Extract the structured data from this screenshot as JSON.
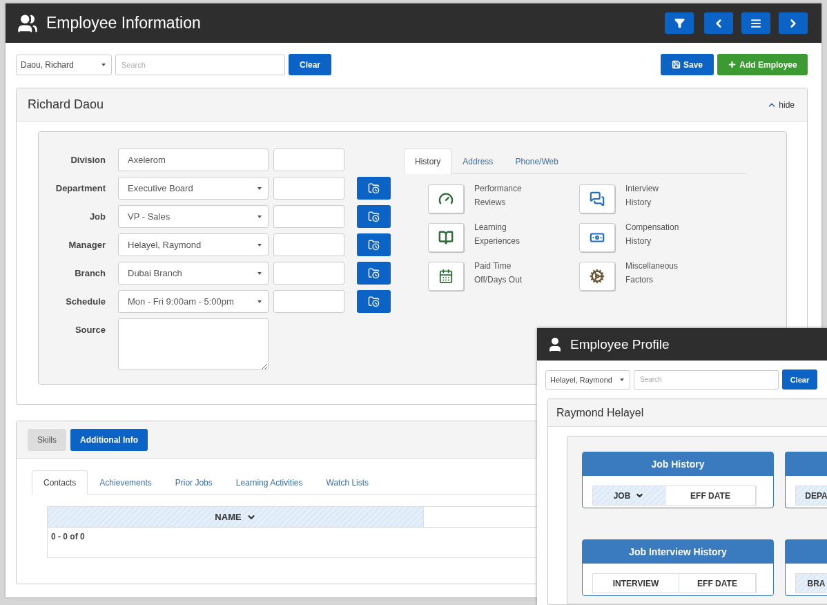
{
  "window": {
    "title": "Employee Information"
  },
  "toolbar": {
    "employee": "Daou, Richard",
    "search": {
      "placeholder": "Search"
    },
    "clear": "Clear",
    "save": "Save",
    "add": "Add Employee"
  },
  "employee_panel": {
    "title": "Richard Daou",
    "hide": "hide",
    "fields": [
      {
        "label": "Division",
        "kind": "text",
        "value": "Axelerom"
      },
      {
        "label": "Department",
        "kind": "select",
        "value": "Executive Board"
      },
      {
        "label": "Job",
        "kind": "select",
        "value": "VP - Sales"
      },
      {
        "label": "Manager",
        "kind": "select",
        "value": "Helayel, Raymond"
      },
      {
        "label": "Branch",
        "kind": "select",
        "value": "Dubai Branch"
      },
      {
        "label": "Schedule",
        "kind": "select",
        "value": "Mon - Fri 9:00am - 5:00pm"
      },
      {
        "label": "Source",
        "kind": "textarea"
      }
    ],
    "tabs": [
      {
        "label": "History",
        "selected": true
      },
      {
        "label": "Address",
        "selected": false
      },
      {
        "label": "Phone/Web",
        "selected": false
      }
    ],
    "links": [
      {
        "label": "Performance Reviews",
        "kind": "gauge"
      },
      {
        "label": "Interview History",
        "kind": "chat"
      },
      {
        "label": "Learning Experiences",
        "kind": "book"
      },
      {
        "label": "Compensation History",
        "kind": "money"
      },
      {
        "label": "Paid Time Off/Days Out",
        "kind": "calendar"
      },
      {
        "label": "Miscellaneous Factors",
        "kind": "gears"
      }
    ]
  },
  "bottom_panel": {
    "tabs": [
      {
        "label": "Skills",
        "selected": false
      },
      {
        "label": "Additional Info",
        "selected": true
      }
    ],
    "subtabs": [
      {
        "label": "Contacts",
        "selected": true
      },
      {
        "label": "Achievements",
        "selected": false
      },
      {
        "label": "Prior Jobs",
        "selected": false
      },
      {
        "label": "Learning Activities",
        "selected": false
      },
      {
        "label": "Watch Lists",
        "selected": false
      }
    ],
    "table": {
      "columns": [
        {
          "label": "NAME",
          "shaded": true,
          "sort_icon": true
        }
      ],
      "footer": "0 - 0 of 0"
    }
  },
  "profile_window": {
    "title": "Employee Profile",
    "employee": "Helayel, Raymond",
    "search": {
      "placeholder": "Search"
    },
    "clear": "Clear",
    "panel_title": "Raymond Helayel",
    "cards": [
      {
        "title": "Job History",
        "columns": [
          {
            "label": "JOB",
            "shaded": true,
            "sort_icon": true
          },
          {
            "label": "EFF DATE",
            "shaded": false,
            "sort_icon": false
          }
        ]
      },
      {
        "columns": [
          {
            "label": "DEPA",
            "shaded": true,
            "sort_icon": false
          }
        ]
      },
      {
        "title": "Job Interview History",
        "columns": [
          {
            "label": "INTERVIEW",
            "shaded": false,
            "sort_icon": false
          },
          {
            "label": "EFF DATE",
            "shaded": false,
            "sort_icon": false
          }
        ]
      },
      {
        "columns": [
          {
            "label": "BRA",
            "shaded": true,
            "sort_icon": false
          }
        ]
      }
    ]
  }
}
